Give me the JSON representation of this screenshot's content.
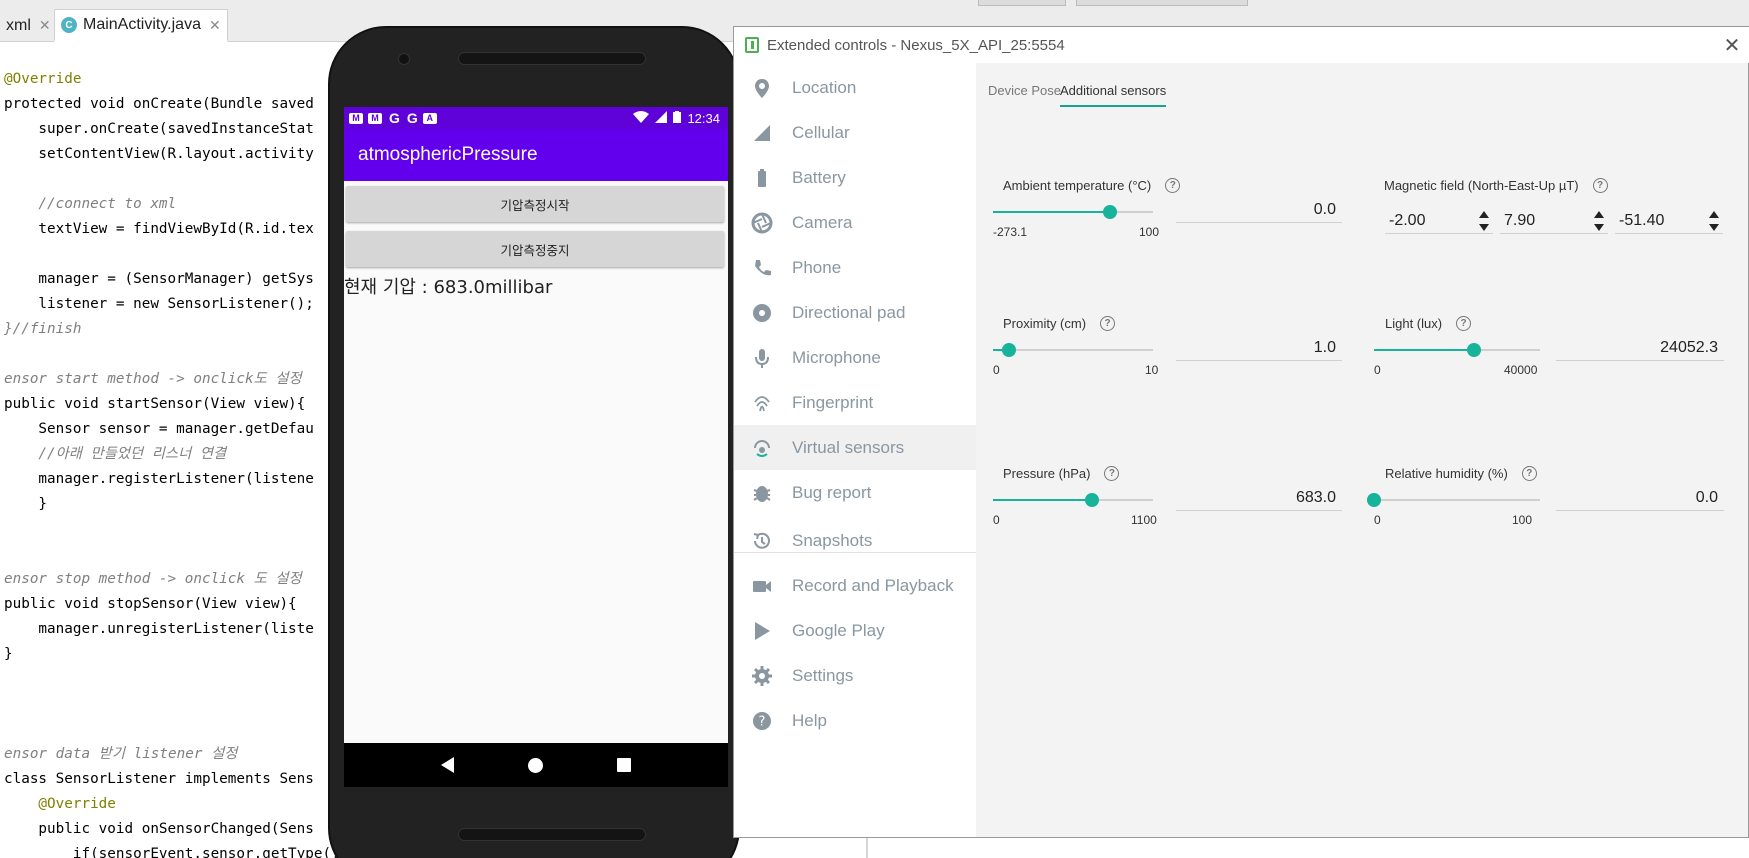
{
  "ide": {
    "tabs": [
      {
        "label": "xml"
      },
      {
        "label": "MainActivity.java",
        "icon": "C"
      }
    ],
    "code_lines": [
      {
        "text": "@Override"
      },
      {
        "text": "protected void onCreate(Bundle saved"
      },
      {
        "text": "    super.onCreate(savedInstanceStat"
      },
      {
        "text": "    setContentView(R.layout.activity"
      },
      {
        "text": ""
      },
      {
        "text": "    //connect to xml"
      },
      {
        "text": "    textView = findViewById(R.id.tex"
      },
      {
        "text": ""
      },
      {
        "text": "    manager = (SensorManager) getSys"
      },
      {
        "text": "    listener = new SensorListener();"
      },
      {
        "text": "}//finish"
      },
      {
        "text": ""
      },
      {
        "text": "ensor start method -> onclick도 설정"
      },
      {
        "text": "public void startSensor(View view){"
      },
      {
        "text": "    Sensor sensor = manager.getDefau"
      },
      {
        "text": "    //아래 만들었던 리스너 연결"
      },
      {
        "text": "    manager.registerListener(listene"
      },
      {
        "text": "    }"
      },
      {
        "text": ""
      },
      {
        "text": ""
      },
      {
        "text": "ensor stop method -> onclick 도 설정"
      },
      {
        "text": "public void stopSensor(View view){"
      },
      {
        "text": "    manager.unregisterListener(liste"
      },
      {
        "text": "}"
      },
      {
        "text": ""
      },
      {
        "text": ""
      },
      {
        "text": ""
      },
      {
        "text": "ensor data 받기 listener 설정"
      },
      {
        "text": "class SensorListener implements Sens"
      },
      {
        "text": "    @Override"
      },
      {
        "text": "    public void onSensorChanged(Sens"
      },
      {
        "text": "        if(sensorEvent.sensor.getType()"
      }
    ]
  },
  "phone": {
    "status_time": "12:34",
    "app_title": "atmosphericPressure",
    "button_start": "기압측정시작",
    "button_stop": "기압측정중지",
    "pressure_readout": "현재 기압 : 683.0millibar",
    "colors": {
      "statusbar": "#5e02d8",
      "appbar": "#6200ee"
    }
  },
  "ext": {
    "title": "Extended controls - Nexus_5X_API_25:5554",
    "sidebar": [
      {
        "label": "Location",
        "icon": "location-pin-icon"
      },
      {
        "label": "Cellular",
        "icon": "cellular-signal-icon"
      },
      {
        "label": "Battery",
        "icon": "battery-icon"
      },
      {
        "label": "Camera",
        "icon": "camera-aperture-icon"
      },
      {
        "label": "Phone",
        "icon": "phone-icon"
      },
      {
        "label": "Directional pad",
        "icon": "dpad-icon"
      },
      {
        "label": "Microphone",
        "icon": "microphone-icon"
      },
      {
        "label": "Fingerprint",
        "icon": "fingerprint-icon"
      },
      {
        "label": "Virtual sensors",
        "icon": "virtual-sensors-icon"
      },
      {
        "label": "Bug report",
        "icon": "bug-icon"
      },
      {
        "label": "Snapshots",
        "icon": "snapshots-history-icon"
      },
      {
        "label": "Record and Playback",
        "icon": "video-camera-icon"
      },
      {
        "label": "Google Play",
        "icon": "google-play-icon"
      },
      {
        "label": "Settings",
        "icon": "gear-icon"
      },
      {
        "label": "Help",
        "icon": "help-icon"
      }
    ],
    "tabs": [
      {
        "label": "Device Pose"
      },
      {
        "label": "Additional sensors"
      }
    ],
    "sensors": {
      "ambient_temperature": {
        "label": "Ambient temperature (°C)",
        "min": "-273.1",
        "max": "100",
        "value": "0.0",
        "fraction": 0.732
      },
      "magnetic_field": {
        "label": "Magnetic field (North-East-Up µT)",
        "x": "-2.00",
        "y": "7.90",
        "z": "-51.40"
      },
      "proximity": {
        "label": "Proximity (cm)",
        "min": "0",
        "max": "10",
        "value": "1.0",
        "fraction": 0.1
      },
      "light": {
        "label": "Light (lux)",
        "min": "0",
        "max": "40000",
        "value": "24052.3",
        "fraction": 0.601
      },
      "pressure": {
        "label": "Pressure (hPa)",
        "min": "0",
        "max": "1100",
        "value": "683.0",
        "fraction": 0.621
      },
      "humidity": {
        "label": "Relative humidity (%)",
        "min": "0",
        "max": "100",
        "value": "0.0",
        "fraction": 0.0
      }
    },
    "accent_color": "#17b39b"
  }
}
